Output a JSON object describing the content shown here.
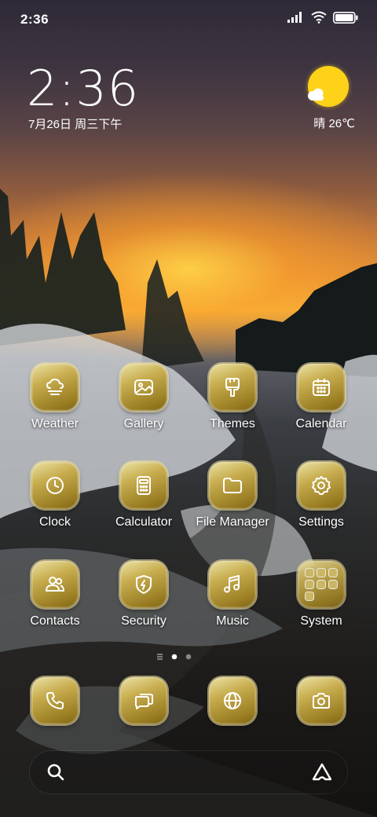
{
  "status_bar": {
    "time": "2:36"
  },
  "lockscreen_clock": {
    "time": "2:36",
    "date": "7月26日 周三下午"
  },
  "weather_widget": {
    "text": "晴 26℃"
  },
  "apps": [
    {
      "label": "Weather",
      "icon": "weather-icon"
    },
    {
      "label": "Gallery",
      "icon": "gallery-icon"
    },
    {
      "label": "Themes",
      "icon": "themes-icon"
    },
    {
      "label": "Calendar",
      "icon": "calendar-icon"
    },
    {
      "label": "Clock",
      "icon": "clock-icon"
    },
    {
      "label": "Calculator",
      "icon": "calculator-icon"
    },
    {
      "label": "File Manager",
      "icon": "folder-icon"
    },
    {
      "label": "Settings",
      "icon": "gear-icon"
    },
    {
      "label": "Contacts",
      "icon": "contacts-icon"
    },
    {
      "label": "Security",
      "icon": "shield-icon"
    },
    {
      "label": "Music",
      "icon": "music-icon"
    },
    {
      "label": "System",
      "icon": "folder-grid-icon"
    }
  ],
  "dock": [
    {
      "icon": "phone-icon"
    },
    {
      "icon": "messages-icon"
    },
    {
      "icon": "browser-icon"
    },
    {
      "icon": "camera-icon"
    }
  ],
  "page_indicator": {
    "current": 2,
    "total": 3
  },
  "colors": {
    "icon_gold": "#c8ae50",
    "sun": "#ffd21a"
  }
}
